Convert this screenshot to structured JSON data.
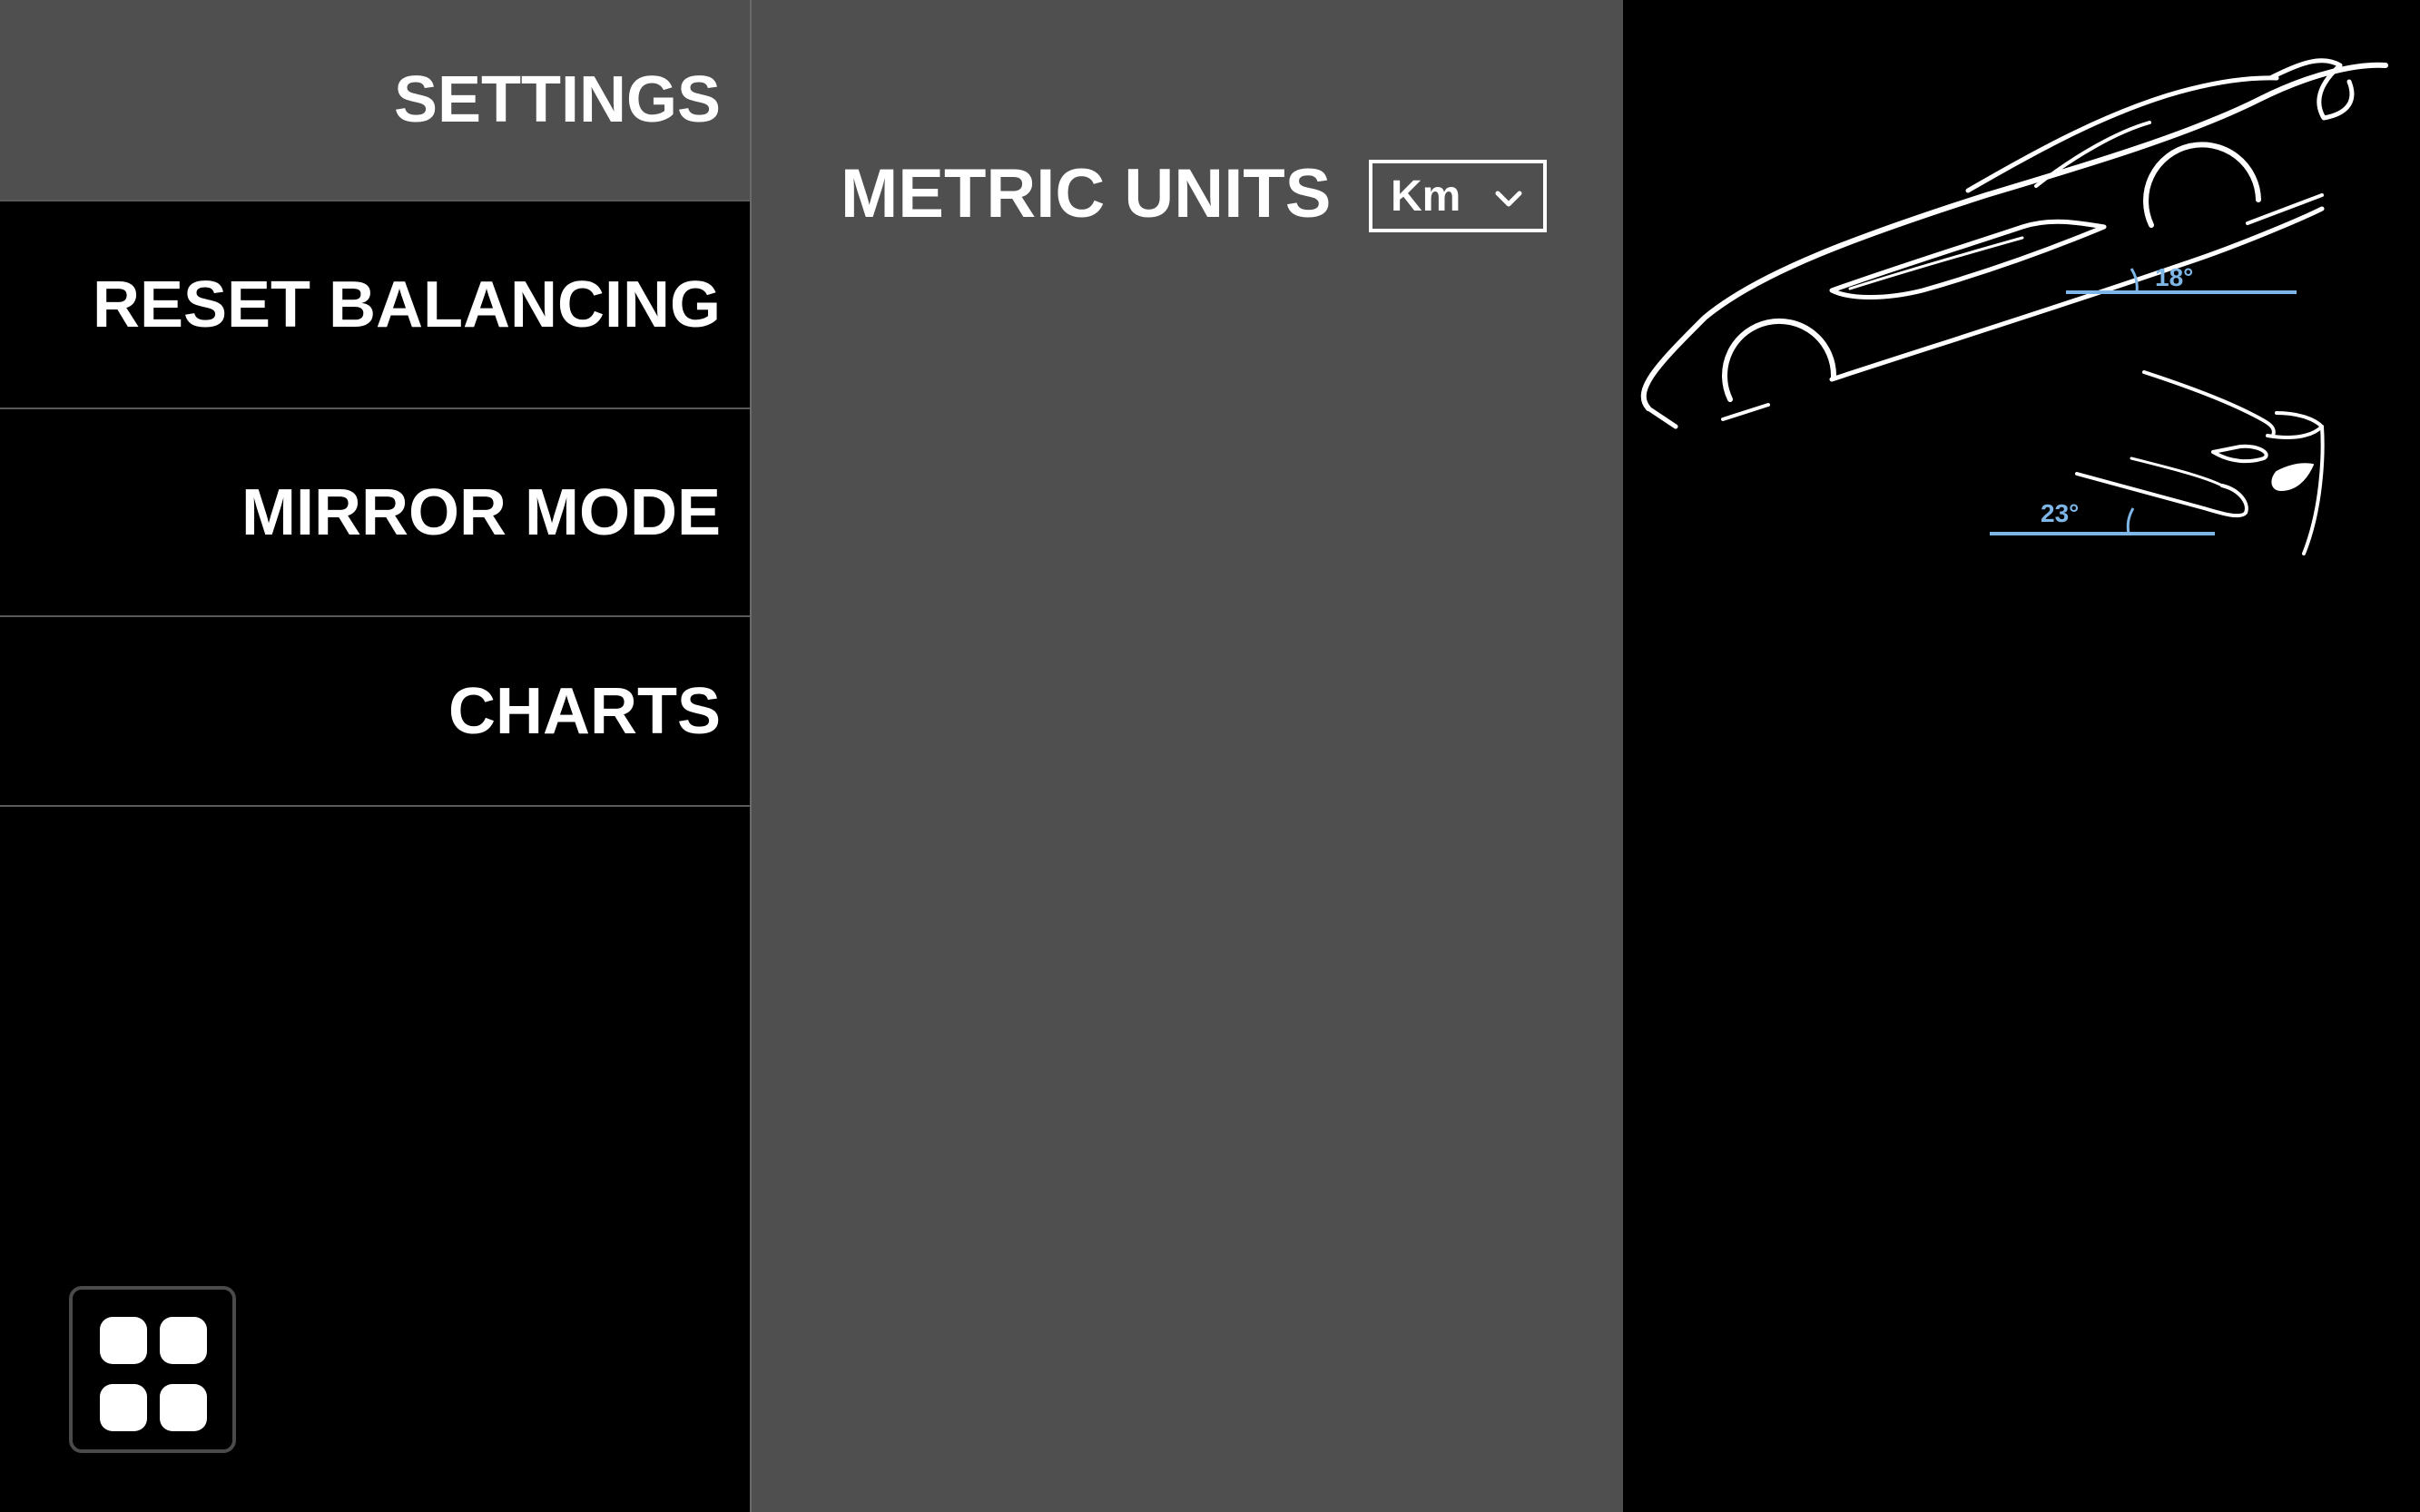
{
  "sidebar": {
    "items": [
      {
        "label": "SETTINGS",
        "active": true
      },
      {
        "label": "RESET BALANCING",
        "active": false
      },
      {
        "label": "MIRROR MODE",
        "active": false
      },
      {
        "label": "CHARTS",
        "active": false
      }
    ],
    "apps_icon": "grid-icon"
  },
  "settings": {
    "metric_units_label": "METRIC UNITS",
    "metric_units_value": "Km",
    "dropdown_icon": "chevron-down-icon"
  },
  "illustration": {
    "approach_angle": "18°",
    "departure_angle": "23°",
    "angle_color": "#7fb6e8"
  },
  "colors": {
    "active_background": "#4f4f4f",
    "background": "#000000",
    "text": "#ffffff"
  }
}
